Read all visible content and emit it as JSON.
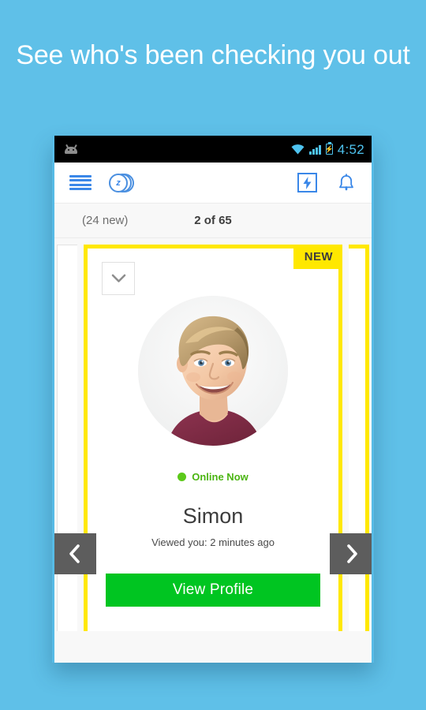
{
  "headline": "See who's been checking you out",
  "colors": {
    "background": "#5fc0e8",
    "accent_yellow": "#ffe800",
    "accent_green": "#00c521",
    "brand_blue": "#3a87e8",
    "status_cyan": "#4ec3ef",
    "online_green": "#5cc91a"
  },
  "status_bar": {
    "robot_icon": "android-robot-icon",
    "wifi_icon": "wifi-icon",
    "signal_icon": "cellular-signal-icon",
    "battery_icon": "battery-charging-icon",
    "time": "4:52"
  },
  "app_bar": {
    "menu_icon": "hamburger-menu-icon",
    "coins_icon": "coin-stack-icon",
    "coins_label": "z",
    "boost_icon": "boost-lightning-icon",
    "notifications_icon": "notification-bell-icon"
  },
  "count_row": {
    "new_count": "(24 new)",
    "position": "2 of 65"
  },
  "carousel": {
    "prev_icon": "chevron-left-icon",
    "next_icon": "chevron-right-icon",
    "card": {
      "badge": "NEW",
      "collapse_icon": "chevron-down-icon",
      "avatar_icon": "profile-photo",
      "online_status": "Online Now",
      "name": "Simon",
      "viewed": "Viewed you: 2 minutes ago",
      "cta_label": "View Profile"
    }
  }
}
